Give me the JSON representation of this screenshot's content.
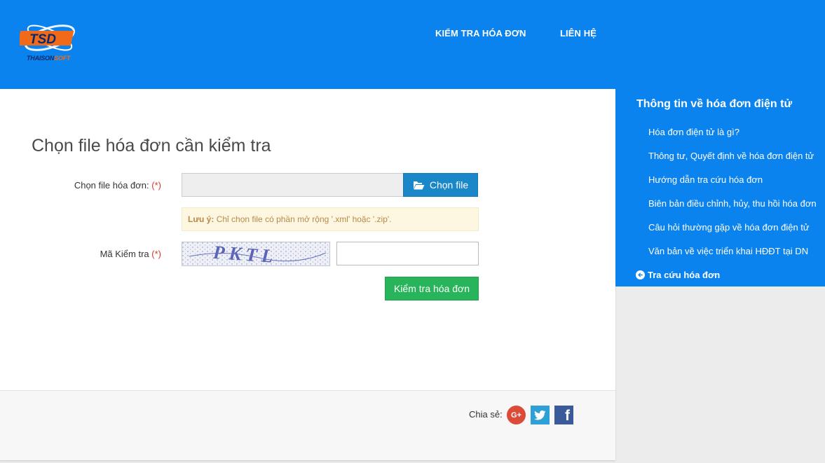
{
  "header": {
    "logo": {
      "text": "TSD",
      "brand_main": "THAISON",
      "brand_accent": "SOFT"
    },
    "nav": [
      {
        "label": "KIỂM TRA HÓA ĐƠN"
      },
      {
        "label": "LIÊN HỆ"
      }
    ]
  },
  "main": {
    "title": "Chọn file hóa đơn cần kiểm tra",
    "file_label": "Chọn file hóa đơn:",
    "required_mark": "(*)",
    "file_value": "",
    "choose_button": "Chọn file",
    "note_bold": "Lưu ý:",
    "note_text": " Chỉ chọn file có phần mở rộng '.xml' hoặc '.zip'.",
    "captcha_label": "Mã Kiểm tra",
    "captcha_text": "PKTL",
    "captcha_value": "",
    "submit_button": "Kiểm tra hóa đơn"
  },
  "footer": {
    "share_label": "Chia sẻ:",
    "icons": [
      "google-plus-icon",
      "twitter-icon",
      "facebook-icon"
    ]
  },
  "sidebar": {
    "title": "Thông tin về hóa đơn điện tử",
    "items": [
      {
        "label": "Hóa đơn điện tử là gì?"
      },
      {
        "label": "Thông tư, Quyết định về hóa đơn điện tử"
      },
      {
        "label": "Hướng dẫn tra cứu hóa đơn"
      },
      {
        "label": "Biên bản điều chỉnh, hủy, thu hồi hóa đơn"
      },
      {
        "label": "Câu hỏi thường gặp về hóa đơn điện tử"
      },
      {
        "label": "Văn bản về việc triển khai HĐĐT tại DN"
      }
    ],
    "lookup": "Tra cứu hóa đơn"
  },
  "colors": {
    "primary": "#0b83ee",
    "choose_button": "#1a87c9",
    "submit_button": "#27b45a",
    "required": "#d9352c",
    "note_bg": "#fdf6e1"
  }
}
